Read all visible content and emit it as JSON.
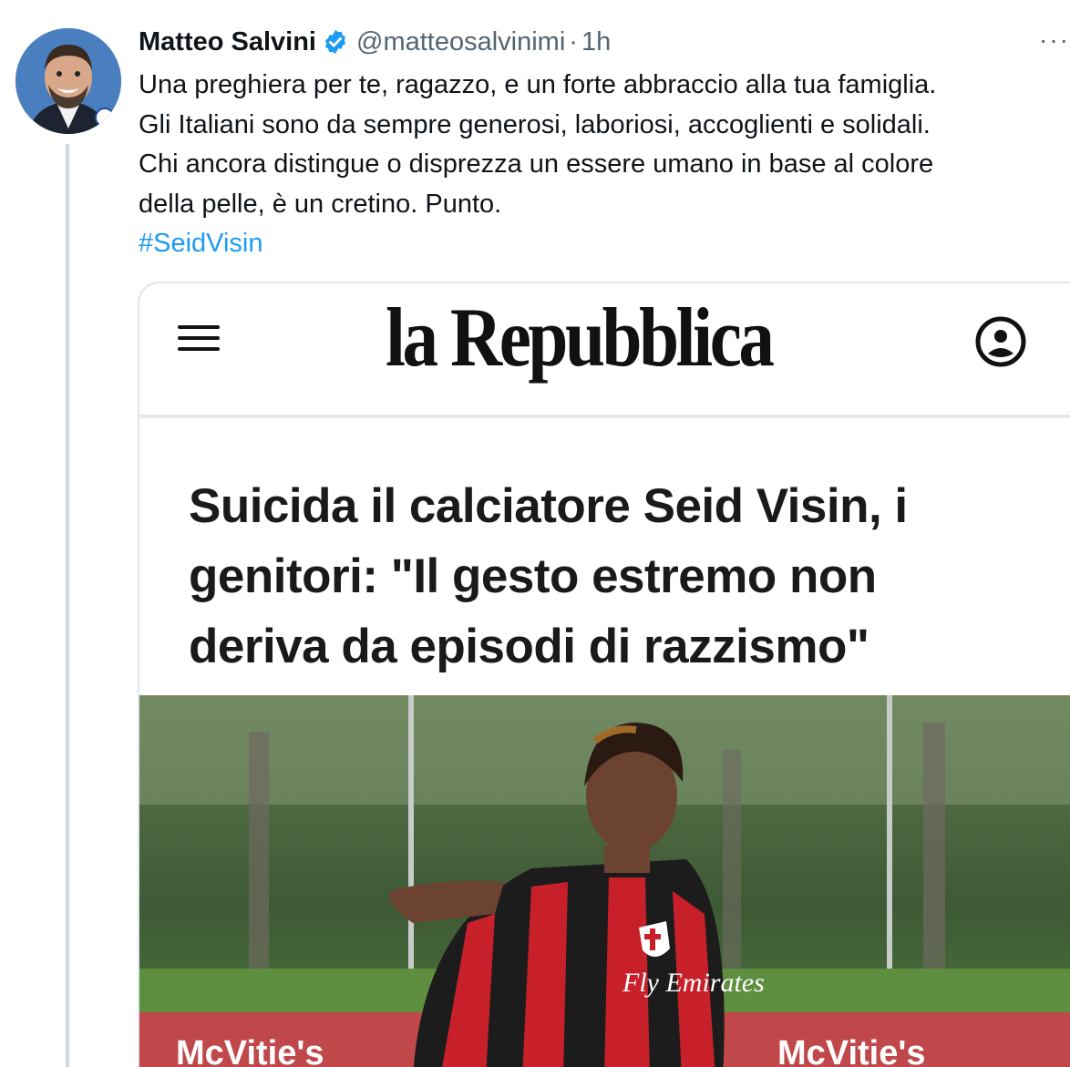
{
  "tweet": {
    "author_name": "Matteo Salvini",
    "author_handle": "@matteosalvinimi",
    "separator": "·",
    "time": "1h",
    "more_label": "···",
    "text_lines": [
      "Una preghiera per te, ragazzo, e un forte abbraccio alla tua famiglia.",
      "Gli Italiani sono da sempre generosi, laboriosi, accoglienti e solidali.",
      "Chi ancora distingue o disprezza un essere umano in base al colore",
      "della pelle, è un cretino. Punto."
    ],
    "hashtag": "#SeidVisin",
    "icons": {
      "verified": "verified-badge-icon",
      "more": "more-options-icon"
    },
    "colors": {
      "link": "#1d9bf0",
      "secondary_text": "#536471",
      "thread_line": "#cfd9de"
    }
  },
  "card": {
    "site_logo": "la Repubblica",
    "headline_lines": [
      "Suicida il calciatore Seid Visin, i",
      "genitori: \"Il gesto estremo non",
      "deriva da episodi di razzismo\""
    ],
    "icons": {
      "menu": "hamburger-menu-icon",
      "account": "user-account-icon"
    },
    "photo_shirt_text": "Fly Emirates",
    "photo_banner_text": "McVitie's"
  }
}
